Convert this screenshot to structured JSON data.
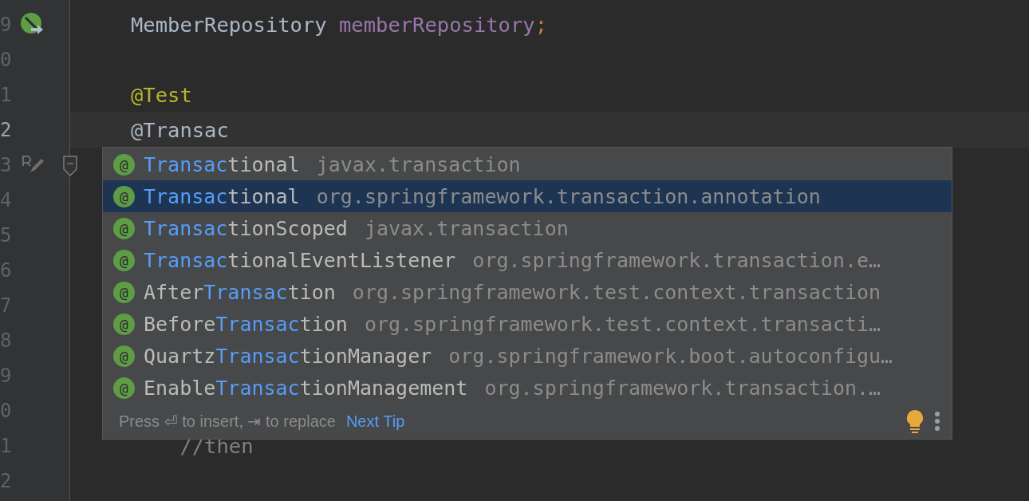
{
  "editor": {
    "lines": [
      {
        "number": "9",
        "gutter_icon": {
          "kind": "run"
        },
        "tokens": [
          {
            "kind": "type",
            "text": "MemberRepository "
          },
          {
            "kind": "field",
            "text": "memberRepository"
          },
          {
            "kind": "punct",
            "text": ";"
          }
        ]
      },
      {
        "number": "0"
      },
      {
        "number": "1",
        "tokens": [
          {
            "kind": "annotation",
            "text": "@Test"
          }
        ]
      },
      {
        "number": "2",
        "current": true,
        "tokens": [
          {
            "kind": "plain",
            "text": "@Transac"
          }
        ]
      },
      {
        "number": "3",
        "gutter_icon": {
          "kind": "edit"
        },
        "fold": true
      },
      {
        "number": "4"
      },
      {
        "number": "5"
      },
      {
        "number": "6"
      },
      {
        "number": "7"
      },
      {
        "number": "8"
      },
      {
        "number": "9"
      },
      {
        "number": "0"
      },
      {
        "number": "1",
        "tokens": [
          {
            "kind": "comment",
            "text": "    //then"
          }
        ]
      },
      {
        "number": "2"
      }
    ]
  },
  "completion": {
    "items": [
      {
        "parts": [
          {
            "text": "Transac",
            "matched": true
          },
          {
            "text": "tional",
            "matched": false
          }
        ],
        "package": "javax.transaction",
        "selected": false
      },
      {
        "parts": [
          {
            "text": "Transac",
            "matched": true
          },
          {
            "text": "tional",
            "matched": false
          }
        ],
        "package": "org.springframework.transaction.annotation",
        "selected": true
      },
      {
        "parts": [
          {
            "text": "Transac",
            "matched": true
          },
          {
            "text": "tionScoped",
            "matched": false
          }
        ],
        "package": "javax.transaction",
        "selected": false
      },
      {
        "parts": [
          {
            "text": "Transac",
            "matched": true
          },
          {
            "text": "tionalEventListener",
            "matched": false
          }
        ],
        "package": "org.springframework.transaction.e…",
        "selected": false
      },
      {
        "parts": [
          {
            "text": "After",
            "matched": false
          },
          {
            "text": "Transac",
            "matched": true
          },
          {
            "text": "tion",
            "matched": false
          }
        ],
        "package": "org.springframework.test.context.transaction",
        "selected": false
      },
      {
        "parts": [
          {
            "text": "Before",
            "matched": false
          },
          {
            "text": "Transac",
            "matched": true
          },
          {
            "text": "tion",
            "matched": false
          }
        ],
        "package": "org.springframework.test.context.transacti…",
        "selected": false
      },
      {
        "parts": [
          {
            "text": "Quartz",
            "matched": false
          },
          {
            "text": "Transac",
            "matched": true
          },
          {
            "text": "tionManager",
            "matched": false
          }
        ],
        "package": "org.springframework.boot.autoconfigu…",
        "selected": false
      },
      {
        "parts": [
          {
            "text": "Enable",
            "matched": false
          },
          {
            "text": "Transac",
            "matched": true
          },
          {
            "text": "tionManagement",
            "matched": false
          }
        ],
        "package": "org.springframework.transaction.…",
        "selected": false
      }
    ],
    "icon_text": "@",
    "hint": "Press ⏎ to insert, ⇥ to replace",
    "link": "Next Tip"
  }
}
